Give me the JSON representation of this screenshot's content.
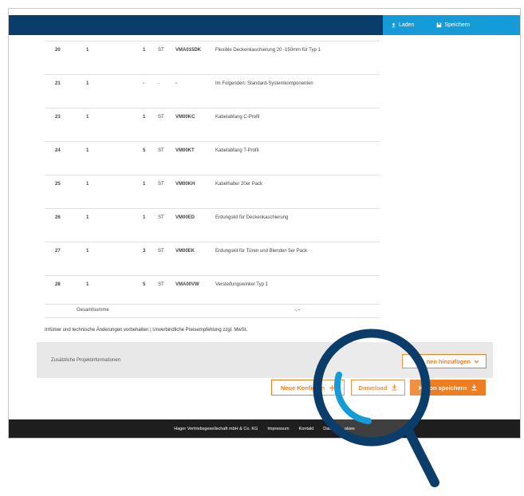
{
  "topbar": {
    "load_label": "Laden",
    "save_label": "Speichern",
    "accent_color": "#159bd7",
    "bg_color": "#0b3d6b"
  },
  "table": {
    "rows": [
      {
        "pos": "20",
        "qty": "1",
        "count": "1",
        "unit": "ST",
        "code": "VMA015DK",
        "desc": "Flexible Deckenkaschierung 20 -150mm für Typ 1"
      },
      {
        "pos": "21",
        "qty": "1",
        "count": "-",
        "unit": "-",
        "code": "-",
        "desc": "Im Folgenden: Standard-Systemkomponenten"
      },
      {
        "pos": "23",
        "qty": "1",
        "count": "1",
        "unit": "ST",
        "code": "VM00KC",
        "desc": "Kabelabfang C-Profil"
      },
      {
        "pos": "24",
        "qty": "1",
        "count": "5",
        "unit": "ST",
        "code": "VM00KT",
        "desc": "Kabelabfang T-Profil"
      },
      {
        "pos": "25",
        "qty": "1",
        "count": "1",
        "unit": "ST",
        "code": "VM00KH",
        "desc": "Kabelhalter 20er Pack"
      },
      {
        "pos": "26",
        "qty": "1",
        "count": "1",
        "unit": "ST",
        "code": "VM00ED",
        "desc": "Erdungskit für Deckenkaschierung"
      },
      {
        "pos": "27",
        "qty": "1",
        "count": "3",
        "unit": "ST",
        "code": "VM00EK",
        "desc": "Erdungskit für Türen und Blenden 5er Pack"
      },
      {
        "pos": "28",
        "qty": "1",
        "count": "5",
        "unit": "ST",
        "code": "VMA00VW",
        "desc": "Versteifungswinkel Typ 1"
      }
    ],
    "sum_label": "Gesamtsumme",
    "sum_value": "-,--"
  },
  "disclaimer": "Irrtümer und technische Änderungen vorbehalten | Unverbindliche Preisempfehlung zzgl. MwSt.",
  "info": {
    "label": "Zusätzliche Projektinformationen",
    "add_button": "nen hinzufügen"
  },
  "actions": {
    "new_config": "Neue Konfigu",
    "new_config_tail": "n",
    "download": "Download",
    "save_pos": "ion speichern",
    "save_pos_lead": "K"
  },
  "footer": {
    "company": "Hager Vertriebsgesellschaft mbH & Co. KG",
    "imprint": "Impressum",
    "contact": "Kontakt",
    "privacy": "Daten",
    "cookies": "okies"
  },
  "colors": {
    "orange": "#ef7d22",
    "magnifier_ring": "#0b3d6b",
    "magnifier_accent": "#159bd7"
  }
}
